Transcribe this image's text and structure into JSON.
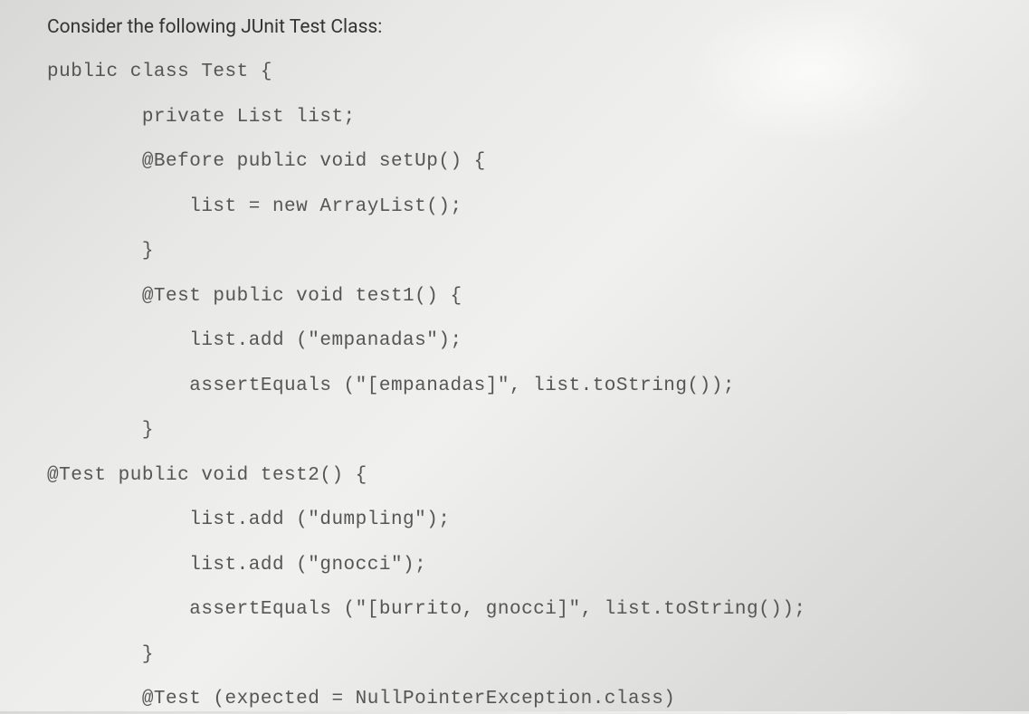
{
  "prompt": "Consider the following JUnit Test Class:",
  "code": {
    "lines": [
      {
        "indent": 0,
        "text": "public class Test {"
      },
      {
        "indent": 8,
        "text": "private List list;"
      },
      {
        "indent": 8,
        "text": "@Before public void setUp() {"
      },
      {
        "indent": 12,
        "text": "list = new ArrayList();"
      },
      {
        "indent": 8,
        "text": "}"
      },
      {
        "indent": 8,
        "text": "@Test public void test1() {"
      },
      {
        "indent": 12,
        "text": "list.add (\"empanadas\");"
      },
      {
        "indent": 12,
        "text": "assertEquals (\"[empanadas]\", list.toString());"
      },
      {
        "indent": 8,
        "text": "}"
      },
      {
        "indent": 0,
        "text": "@Test public void test2() {"
      },
      {
        "indent": 12,
        "text": "list.add (\"dumpling\");"
      },
      {
        "indent": 12,
        "text": "list.add (\"gnocci\");"
      },
      {
        "indent": 12,
        "text": "assertEquals (\"[burrito, gnocci]\", list.toString());"
      },
      {
        "indent": 8,
        "text": "}"
      },
      {
        "indent": 8,
        "text": "@Test (expected = NullPointerException.class)"
      }
    ]
  }
}
